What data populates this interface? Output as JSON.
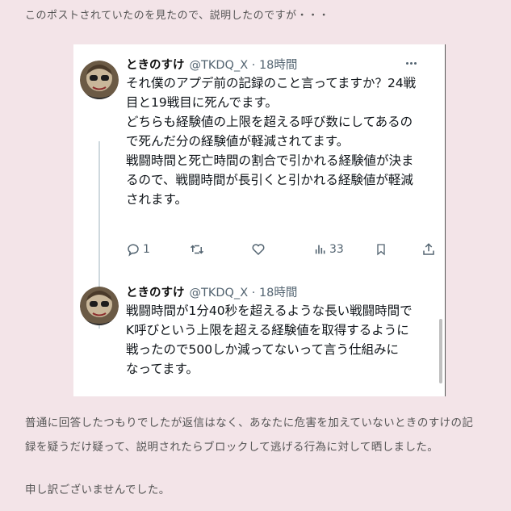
{
  "intro": "このポストされていたのを見たので、説明したのですが・・・",
  "tweets": [
    {
      "name": "ときのすけ",
      "handle": "@TKDQ_X · 18時間",
      "lines": [
        "それ僕のアプデ前の記録のこと言ってますか？24戦",
        "目と19戦目に死んでます。",
        "どちらも経験値の上限を超える呼び数にしてあるの",
        "で死んだ分の経験値が軽減されてます。",
        "戦闘時間と死亡時間の割合で引かれる経験値が決ま",
        "るので、戦闘時間が長引くと引かれる経験値が軽減",
        "されます。"
      ],
      "actions": {
        "reply_count": "1",
        "retweet_count": "",
        "like_count": "",
        "views_count": "33"
      }
    },
    {
      "name": "ときのすけ",
      "handle": "@TKDQ_X · 18時間",
      "lines": [
        "戦闘時間が1分40秒を超えるような長い戦闘時間で",
        "K呼びという上限を超える経験値を取得するように",
        "戦ったので500しか減ってないって言う仕組みに",
        "なってます。"
      ]
    }
  ],
  "paragraphs": {
    "p1_line1": "普通に回答したつもりでしたが返信はなく、あなたに危害を加えていないときのすけの記",
    "p1_line2": "録を疑うだけ疑って、説明されたらブロックして逃げる行為に対して晒しました。",
    "p2": "申し訳ございませんでした。"
  },
  "icons": [
    "more-icon",
    "reply-icon",
    "retweet-icon",
    "like-icon",
    "views-icon",
    "bookmark-icon",
    "share-icon"
  ],
  "colors": {
    "page_background": "#f3e4e8",
    "card_background": "#ffffff",
    "secondary_text": "#536471"
  }
}
